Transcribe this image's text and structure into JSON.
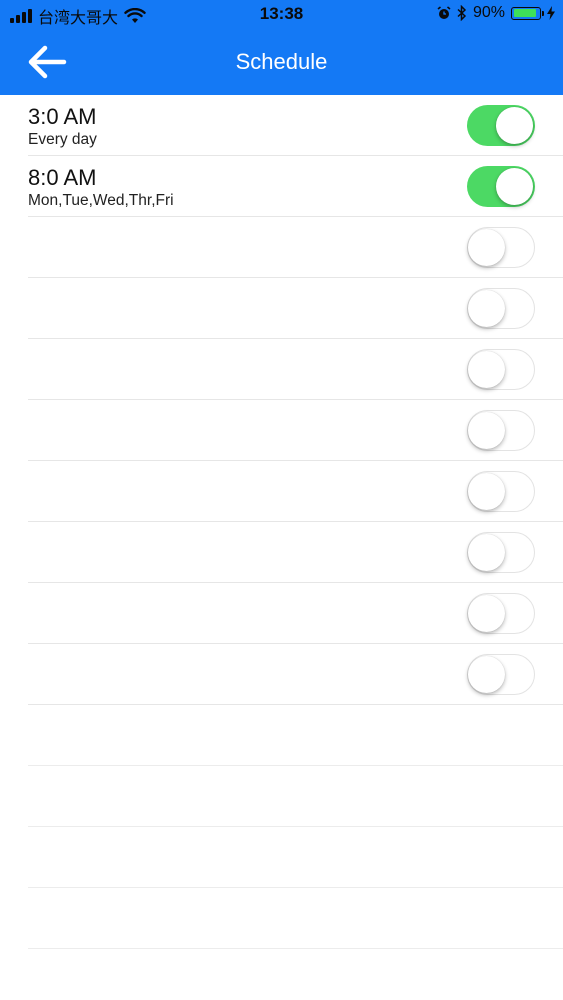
{
  "status_bar": {
    "carrier": "台湾大哥大",
    "time": "13:38",
    "battery_percent": "90%",
    "battery_level": 0.9,
    "icons": [
      "signal-icon",
      "wifi-icon",
      "alarm-icon",
      "bluetooth-icon",
      "battery-icon",
      "charging-icon"
    ]
  },
  "nav": {
    "title": "Schedule",
    "back_icon": "arrow-left-icon"
  },
  "colors": {
    "accent": "#1479f5",
    "toggle_on": "#4cd964"
  },
  "schedules": [
    {
      "time": "3:0 AM",
      "days": "Every day",
      "enabled": true
    },
    {
      "time": "8:0 AM",
      "days": "Mon,Tue,Wed,Thr,Fri",
      "enabled": true
    },
    {
      "time": "",
      "days": "",
      "enabled": false
    },
    {
      "time": "",
      "days": "",
      "enabled": false
    },
    {
      "time": "",
      "days": "",
      "enabled": false
    },
    {
      "time": "",
      "days": "",
      "enabled": false
    },
    {
      "time": "",
      "days": "",
      "enabled": false
    },
    {
      "time": "",
      "days": "",
      "enabled": false
    },
    {
      "time": "",
      "days": "",
      "enabled": false
    },
    {
      "time": "",
      "days": "",
      "enabled": false
    }
  ]
}
